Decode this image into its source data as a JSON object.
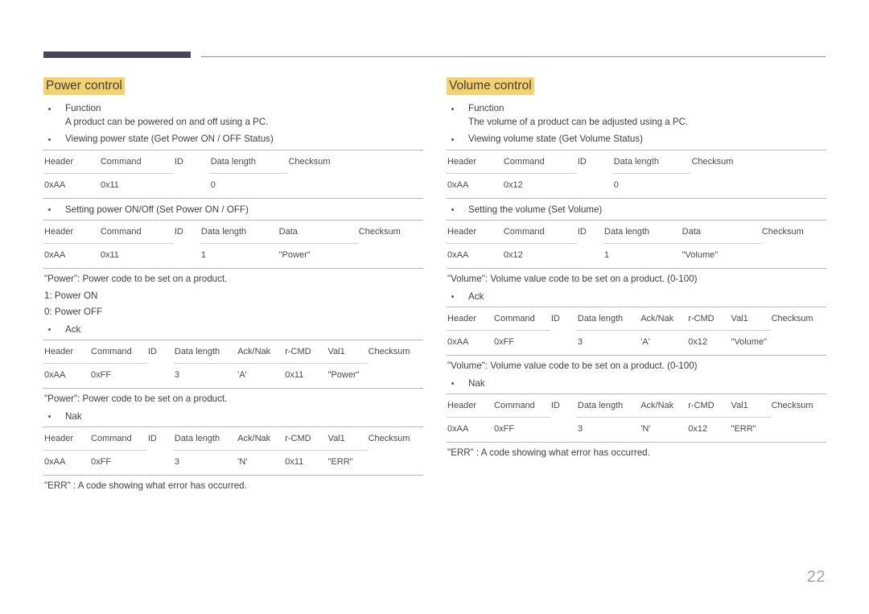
{
  "page": {
    "number": "22",
    "header_rule": {
      "dark_color": "#474757",
      "line_color": "#8d8d8d"
    },
    "highlight_color": "#f2d272"
  },
  "columns": [
    {
      "id": "power-control",
      "heading": "Power control",
      "blocks": [
        {
          "type": "bullet",
          "label": "Function",
          "sub": "A product can be powered on and off using a PC."
        },
        {
          "type": "bullet",
          "label": "Viewing power state (Get Power ON / OFF Status)"
        },
        {
          "type": "table",
          "columns": [
            "Header",
            "Command",
            "ID",
            "Data length",
            "Checksum"
          ],
          "row": [
            "0xAA",
            "0x11",
            "",
            "0",
            ""
          ]
        },
        {
          "type": "bullet",
          "label": "Setting power ON/Off (Set Power ON / OFF)"
        },
        {
          "type": "table",
          "columns": [
            "Header",
            "Command",
            "ID",
            "Data length",
            "Data",
            "Checksum"
          ],
          "row": [
            "0xAA",
            "0x11",
            "",
            "1",
            "\"Power\"",
            ""
          ]
        },
        {
          "type": "note",
          "text": "\"Power\": Power code to be set on a product."
        },
        {
          "type": "note",
          "text": "1: Power ON"
        },
        {
          "type": "note",
          "text": "0: Power OFF"
        },
        {
          "type": "bullet",
          "label": "Ack"
        },
        {
          "type": "table",
          "columns": [
            "Header",
            "Command",
            "ID",
            "Data length",
            "Ack/Nak",
            "r-CMD",
            "Val1",
            "Checksum"
          ],
          "row": [
            "0xAA",
            "0xFF",
            "",
            "3",
            "'A'",
            "0x11",
            "\"Power\"",
            ""
          ]
        },
        {
          "type": "note",
          "text": "\"Power\": Power code to be set on a product."
        },
        {
          "type": "bullet",
          "label": "Nak"
        },
        {
          "type": "table",
          "columns": [
            "Header",
            "Command",
            "ID",
            "Data length",
            "Ack/Nak",
            "r-CMD",
            "Val1",
            "Checksum"
          ],
          "row": [
            "0xAA",
            "0xFF",
            "",
            "3",
            "'N'",
            "0x11",
            "\"ERR\"",
            ""
          ]
        },
        {
          "type": "note",
          "text": "\"ERR\" : A code showing what error has occurred."
        }
      ]
    },
    {
      "id": "volume-control",
      "heading": "Volume control",
      "blocks": [
        {
          "type": "bullet",
          "label": "Function",
          "sub": "The volume of a product can be adjusted using a PC."
        },
        {
          "type": "bullet",
          "label": "Viewing volume state (Get Volume Status)"
        },
        {
          "type": "table",
          "columns": [
            "Header",
            "Command",
            "ID",
            "Data length",
            "Checksum"
          ],
          "row": [
            "0xAA",
            "0x12",
            "",
            "0",
            ""
          ]
        },
        {
          "type": "bullet",
          "label": "Setting the volume (Set Volume)"
        },
        {
          "type": "table",
          "columns": [
            "Header",
            "Command",
            "ID",
            "Data length",
            "Data",
            "Checksum"
          ],
          "row": [
            "0xAA",
            "0x12",
            "",
            "1",
            "\"Volume\"",
            ""
          ]
        },
        {
          "type": "note",
          "text": "\"Volume\": Volume value code to be set on a product. (0-100)"
        },
        {
          "type": "bullet",
          "label": "Ack"
        },
        {
          "type": "table",
          "columns": [
            "Header",
            "Command",
            "ID",
            "Data length",
            "Ack/Nak",
            "r-CMD",
            "Val1",
            "Checksum"
          ],
          "row": [
            "0xAA",
            "0xFF",
            "",
            "3",
            "'A'",
            "0x12",
            "\"Volume\"",
            ""
          ]
        },
        {
          "type": "note",
          "text": "\"Volume\": Volume value code to be set on a product. (0-100)"
        },
        {
          "type": "bullet",
          "label": "Nak"
        },
        {
          "type": "table",
          "columns": [
            "Header",
            "Command",
            "ID",
            "Data length",
            "Ack/Nak",
            "r-CMD",
            "Val1",
            "Checksum"
          ],
          "row": [
            "0xAA",
            "0xFF",
            "",
            "3",
            "'N'",
            "0x12",
            "\"ERR\"",
            ""
          ]
        },
        {
          "type": "note",
          "text": "\"ERR\" : A code showing what error has occurred."
        }
      ]
    }
  ]
}
